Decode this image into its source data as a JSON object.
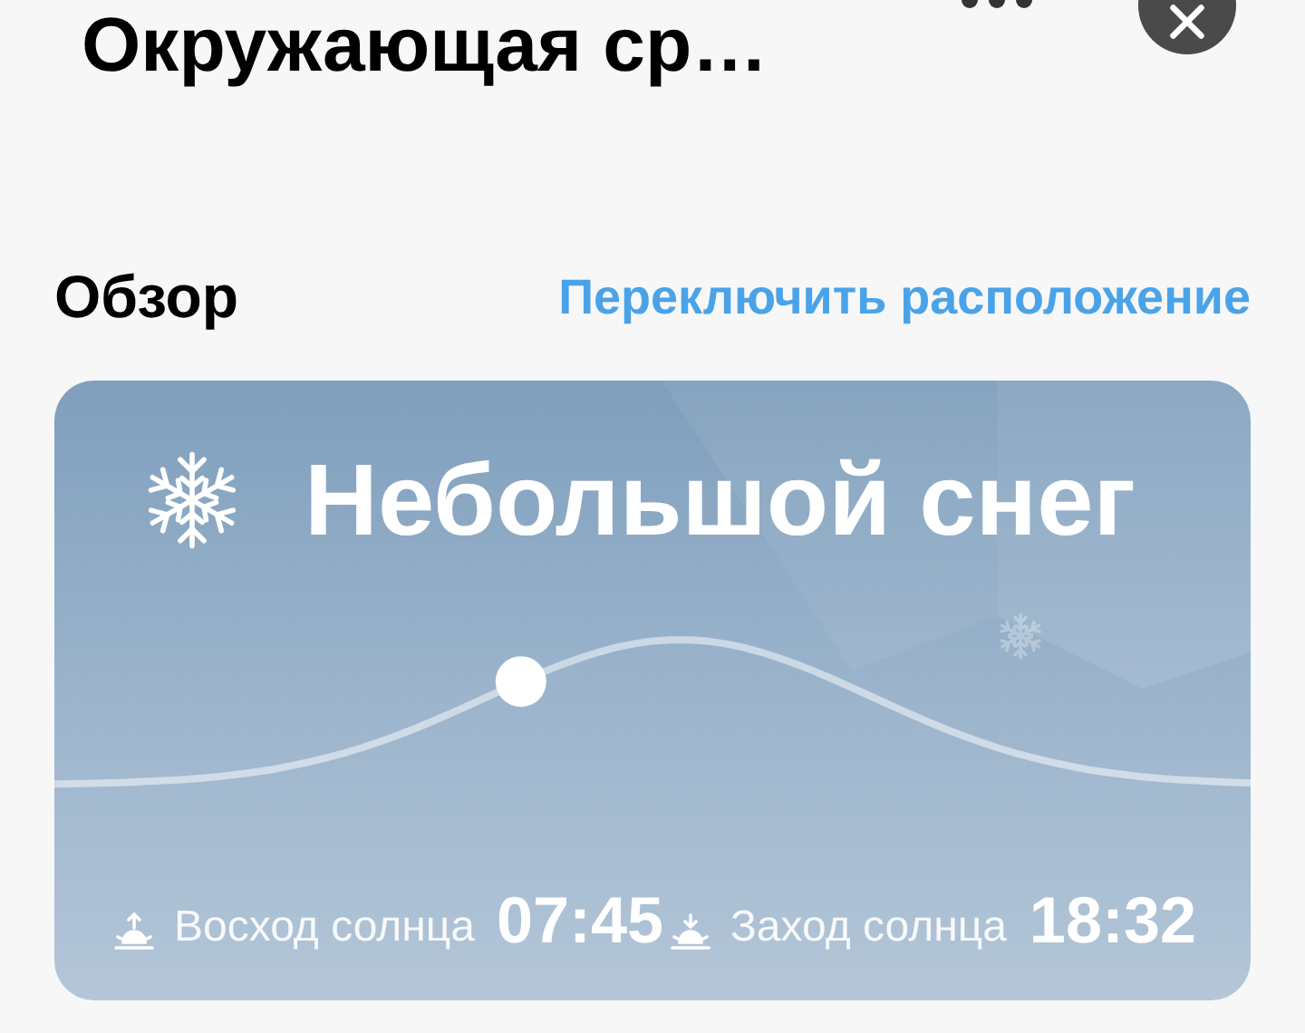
{
  "header": {
    "title": "Окружающая ср…"
  },
  "section": {
    "title": "Обзор",
    "link": "Переключить расположение"
  },
  "weather": {
    "condition": "Небольшой снег",
    "sun_path": {
      "level": 0.39
    },
    "sunrise": {
      "label": "Восход солнца",
      "time": "07:45"
    },
    "sunset": {
      "label": "Заход солнца",
      "time": "18:32"
    }
  }
}
